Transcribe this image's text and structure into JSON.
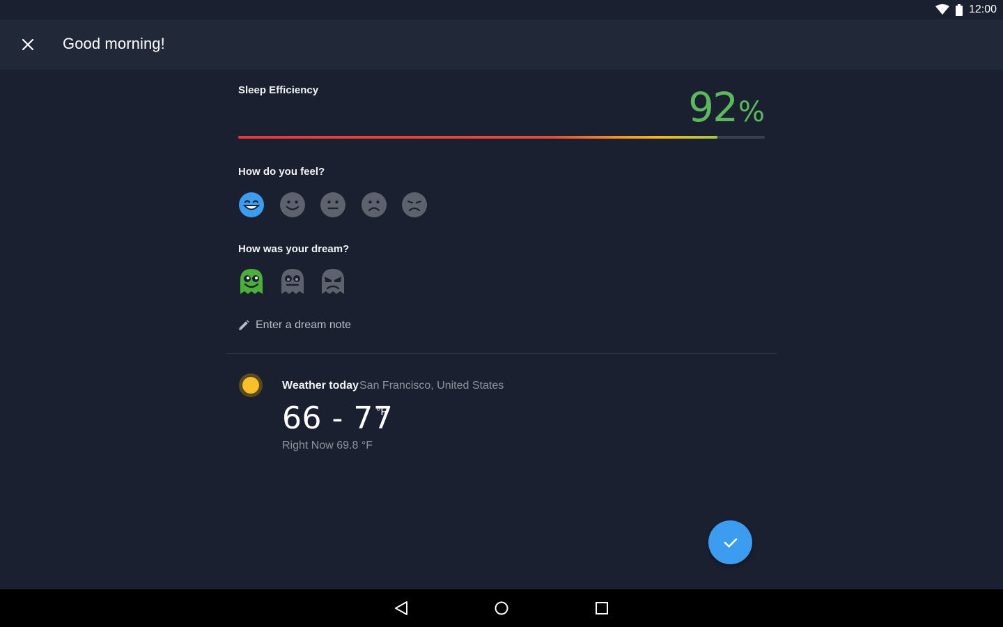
{
  "status_bar": {
    "time": "12:00",
    "icons": [
      "wifi-icon",
      "battery-icon"
    ]
  },
  "app_bar": {
    "title": "Good morning!",
    "close_icon": "close-icon"
  },
  "sleep_efficiency": {
    "label": "Sleep Efficiency",
    "value": "92",
    "unit": "%",
    "bar_fraction": 0.91,
    "value_color": "#5cb85c"
  },
  "feel": {
    "label": "How do you feel?",
    "options": [
      "very-happy",
      "happy",
      "neutral",
      "sad",
      "very-sad"
    ],
    "selected": "very-happy",
    "selected_color": "#3b9cf0",
    "unselected_color": "#5d626d"
  },
  "dream": {
    "label": "How was your dream?",
    "options": [
      "good-dream",
      "neutral-dream",
      "bad-dream"
    ],
    "selected": "good-dream",
    "selected_color": "#4caf3a",
    "note_placeholder": "Enter a dream note"
  },
  "weather": {
    "icon": "sun-icon",
    "title": "Weather today",
    "location": "San Francisco, United States",
    "range": "66 - 77",
    "unit": "°F",
    "right_now": "Right Now 69.8 °F"
  },
  "fab": {
    "icon": "check-icon",
    "color": "#3b9cf0"
  },
  "nav_bar": {
    "buttons": [
      "back-icon",
      "home-icon",
      "recents-icon"
    ]
  }
}
